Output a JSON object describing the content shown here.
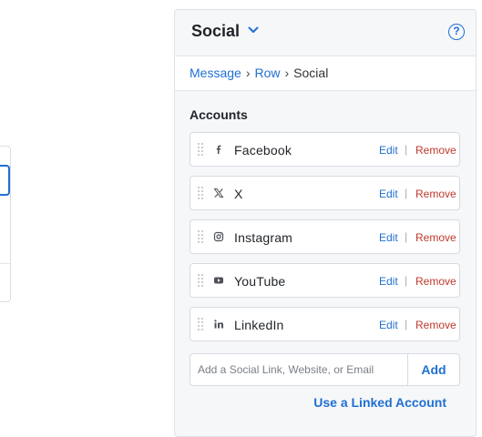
{
  "panel": {
    "title": "Social",
    "help_glyph": "?",
    "breadcrumb": {
      "items": [
        "Message",
        "Row"
      ],
      "current": "Social",
      "separator": "›"
    }
  },
  "accounts": {
    "section_title": "Accounts",
    "edit_label": "Edit",
    "remove_label": "Remove",
    "divider": "|",
    "items": [
      {
        "name": "Facebook",
        "icon": "facebook-icon"
      },
      {
        "name": "X",
        "icon": "x-icon"
      },
      {
        "name": "Instagram",
        "icon": "instagram-icon"
      },
      {
        "name": "YouTube",
        "icon": "youtube-icon"
      },
      {
        "name": "LinkedIn",
        "icon": "linkedin-icon"
      }
    ]
  },
  "add_form": {
    "placeholder": "Add a Social Link, Website, or Email",
    "value": "",
    "button_label": "Add"
  },
  "linked_account_label": "Use a Linked Account",
  "colors": {
    "accent": "#1f6fd1",
    "remove": "#c0392b",
    "panel_bg": "#f6f7f9"
  }
}
